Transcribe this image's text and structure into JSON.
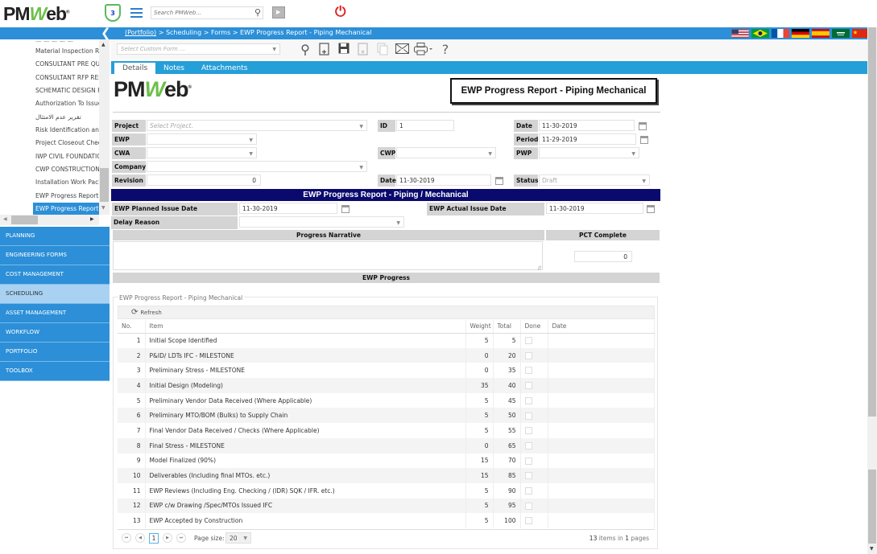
{
  "header": {
    "logo_text_pm": "PM",
    "logo_text_w": "W",
    "logo_text_eb": "eb",
    "logo_reg": "®",
    "notification_count": "3",
    "search_placeholder": "Search PMWeb...",
    "icons": [
      "shield-badge-icon",
      "hamburger-menu-icon",
      "search-icon",
      "video-icon",
      "power-icon"
    ]
  },
  "breadcrumb": {
    "portfolio": "(Portfolio)",
    "path": " > Scheduling > Forms > EWP Progress Report - Piping Mechanical"
  },
  "languages": [
    "English (US)",
    "Portuguese (Brazil)",
    "French",
    "German",
    "Spanish",
    "Arabic (Saudi Arabia)",
    "Chinese"
  ],
  "tree": {
    "items": [
      "Material Inspection Re",
      "CONSULTANT PRE QU",
      "CONSULTANT RFP RES",
      "SCHEMATIC DESIGN F",
      "Authorization To Issue",
      "تقرير عدم الامتثال",
      "Risk Identification and",
      "Project Closeout Chec",
      "IWP CIVIL FOUNDATIC",
      "CWP CONSTRUCTION",
      "Installation Work Pack",
      "EWP Progress Report",
      "EWP Progress Report"
    ],
    "selected_index": 12
  },
  "modules": [
    {
      "label": "PLANNING",
      "active": false
    },
    {
      "label": "ENGINEERING FORMS",
      "active": false
    },
    {
      "label": "COST MANAGEMENT",
      "active": false
    },
    {
      "label": "SCHEDULING",
      "active": true
    },
    {
      "label": "ASSET MANAGEMENT",
      "active": false
    },
    {
      "label": "WORKFLOW",
      "active": false
    },
    {
      "label": "PORTFOLIO",
      "active": false
    },
    {
      "label": "TOOLBOX",
      "active": false
    }
  ],
  "toolbar": {
    "custom_form_placeholder": "Select Custom Form ...",
    "icons": [
      "search-icon",
      "new-icon",
      "save-icon",
      "delete-icon",
      "copy-icon",
      "email-icon",
      "print-icon",
      "help-icon"
    ]
  },
  "tabs": [
    "Details",
    "Notes",
    "Attachments"
  ],
  "form": {
    "title": "EWP Progress Report - Piping Mechanical",
    "labels": {
      "project": "Project",
      "ewp": "EWP",
      "cwa": "CWA",
      "company": "Company",
      "revision": "Revision",
      "id": "ID",
      "cwp": "CWP",
      "date": "Date",
      "period": "Period",
      "pwp": "PWP",
      "status": "Status"
    },
    "values": {
      "project_placeholder": "Select Project.",
      "ewp": "",
      "cwa": "",
      "company": "",
      "revision": "0",
      "id": "1",
      "cwp": "",
      "revision_date": "11-30-2019",
      "date": "11-30-2019",
      "period": "11-29-2019",
      "pwp": "",
      "status": "Draft"
    }
  },
  "section": {
    "title": "EWP Progress Report - Piping / Mechanical",
    "planned_label": "EWP Planned Issue Date",
    "planned_value": "11-30-2019",
    "actual_label": "EWP Actual Issue Date",
    "actual_value": "11-30-2019",
    "delay_label": "Delay Reason",
    "delay_value": "",
    "narrative_header": "Progress Narrative",
    "narrative_value": "",
    "pct_header": "PCT Complete",
    "pct_value": "0",
    "progress_header": "EWP Progress"
  },
  "grid": {
    "caption": "EWP Progress Report - Piping Mechanical",
    "refresh_label": "Refresh",
    "columns": [
      "No.",
      "Item",
      "Weight",
      "Total",
      "Done",
      "Date"
    ],
    "rows": [
      {
        "no": "1",
        "item": "Initial Scope Identified",
        "weight": "5",
        "total": "5",
        "done": false,
        "date": ""
      },
      {
        "no": "2",
        "item": "P&ID/ LDTs IFC - MILESTONE",
        "weight": "0",
        "total": "20",
        "done": false,
        "date": ""
      },
      {
        "no": "3",
        "item": "Preliminary Stress - MILESTONE",
        "weight": "0",
        "total": "35",
        "done": false,
        "date": ""
      },
      {
        "no": "4",
        "item": "Initial Design (Modeling)",
        "weight": "35",
        "total": "40",
        "done": false,
        "date": ""
      },
      {
        "no": "5",
        "item": "Preliminary Vendor Data Received (Where Applicable)",
        "weight": "5",
        "total": "45",
        "done": false,
        "date": ""
      },
      {
        "no": "6",
        "item": "Preliminary MTO/BOM (Bulks) to Supply Chain",
        "weight": "5",
        "total": "50",
        "done": false,
        "date": ""
      },
      {
        "no": "7",
        "item": "Final Vendor Data Received / Checks (Where Applicable)",
        "weight": "5",
        "total": "55",
        "done": false,
        "date": ""
      },
      {
        "no": "8",
        "item": "Final Stress - MILESTONE",
        "weight": "0",
        "total": "65",
        "done": false,
        "date": ""
      },
      {
        "no": "9",
        "item": "Model Finalized (90%)",
        "weight": "15",
        "total": "70",
        "done": false,
        "date": ""
      },
      {
        "no": "10",
        "item": "Deliverables (Including final MTOs. etc.)",
        "weight": "15",
        "total": "85",
        "done": false,
        "date": ""
      },
      {
        "no": "11",
        "item": "EWP Reviews (Including Eng. Checking / (IDR) SQK / IFR. etc.)",
        "weight": "5",
        "total": "90",
        "done": false,
        "date": ""
      },
      {
        "no": "12",
        "item": "EWP c/w Drawing /Spec/MTOs Issued IFC",
        "weight": "5",
        "total": "95",
        "done": false,
        "date": ""
      },
      {
        "no": "13",
        "item": "EWP Accepted by Construction",
        "weight": "5",
        "total": "100",
        "done": false,
        "date": ""
      }
    ],
    "pager": {
      "current_page": "1",
      "page_size_label": "Page size:",
      "page_size": "20",
      "item_count": "13",
      "items_in": " items in ",
      "page_count": "1",
      "pages": " pages"
    }
  },
  "colors": {
    "primary_blue": "#2c8fd8",
    "tab_blue": "#259fd8",
    "section_navy": "#0a0a6e",
    "label_gray": "#d4d4d4",
    "logo_green": "#6cc04a",
    "power_red": "#e02020"
  }
}
